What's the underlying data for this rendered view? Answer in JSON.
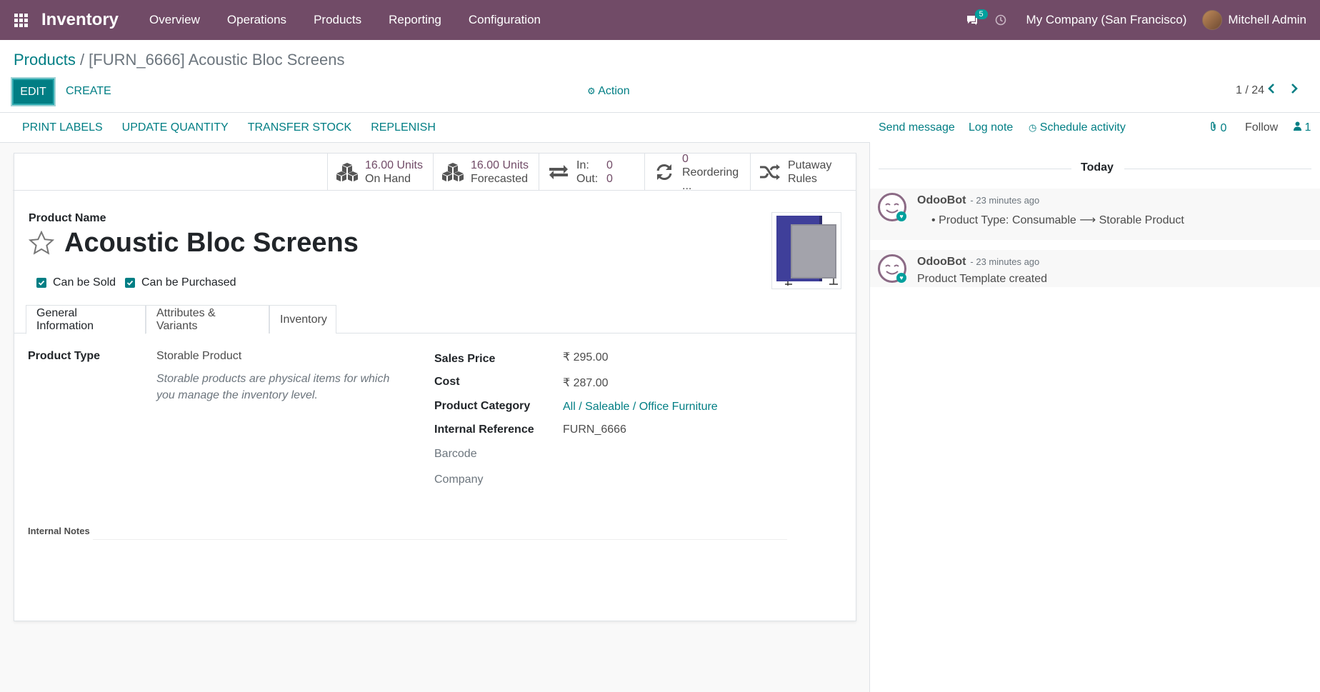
{
  "navbar": {
    "app_title": "Inventory",
    "menu": [
      "Overview",
      "Operations",
      "Products",
      "Reporting",
      "Configuration"
    ],
    "messages_count": "5",
    "company": "My Company (San Francisco)",
    "user": "Mitchell Admin"
  },
  "control": {
    "breadcrumb_parent": "Products",
    "breadcrumb_sep": " / ",
    "breadcrumb_current": "[FURN_6666] Acoustic Bloc Screens",
    "edit_label": "EDIT",
    "create_label": "CREATE",
    "action_label": "Action",
    "pager": "1 / 24"
  },
  "statusbar": {
    "buttons": [
      "PRINT LABELS",
      "UPDATE QUANTITY",
      "TRANSFER STOCK",
      "REPLENISH"
    ]
  },
  "smart_buttons": {
    "on_hand_value": "16.00 Units",
    "on_hand_label": "On Hand",
    "forecasted_value": "16.00 Units",
    "forecasted_label": "Forecasted",
    "in_label": "In:",
    "in_value": "0",
    "out_label": "Out:",
    "out_value": "0",
    "reordering_value": "0",
    "reordering_label": "Reordering ...",
    "putaway_line1": "Putaway",
    "putaway_line2": "Rules"
  },
  "product": {
    "name_label": "Product Name",
    "name": "Acoustic Bloc Screens",
    "can_be_sold": "Can be Sold",
    "can_be_purchased": "Can be Purchased"
  },
  "tabs": [
    "General Information",
    "Attributes & Variants",
    "Inventory"
  ],
  "general": {
    "product_type_label": "Product Type",
    "product_type": "Storable Product",
    "product_type_help": "Storable products are physical items for which you manage the inventory level.",
    "sales_price_label": "Sales Price",
    "sales_price": "₹ 295.00",
    "cost_label": "Cost",
    "cost": "₹ 287.00",
    "category_label": "Product Category",
    "category": "All / Saleable / Office Furniture",
    "internal_ref_label": "Internal Reference",
    "internal_ref": "FURN_6666",
    "barcode_label": "Barcode",
    "company_label": "Company",
    "internal_notes_label": "Internal Notes"
  },
  "chatter": {
    "send_message": "Send message",
    "log_note": "Log note",
    "schedule_activity": "Schedule activity",
    "attachments": "0",
    "follow": "Follow",
    "followers": "1",
    "today": "Today",
    "messages": [
      {
        "author": "OdooBot",
        "time": "- 23 minutes ago",
        "field": "Product Type:",
        "old": "Consumable",
        "arrow": "⟶",
        "new": "Storable Product"
      },
      {
        "author": "OdooBot",
        "time": "- 23 minutes ago",
        "body": "Product Template created"
      }
    ]
  },
  "colors": {
    "brand": "#714b67",
    "accent": "#017e84",
    "badge": "#00a09d"
  }
}
